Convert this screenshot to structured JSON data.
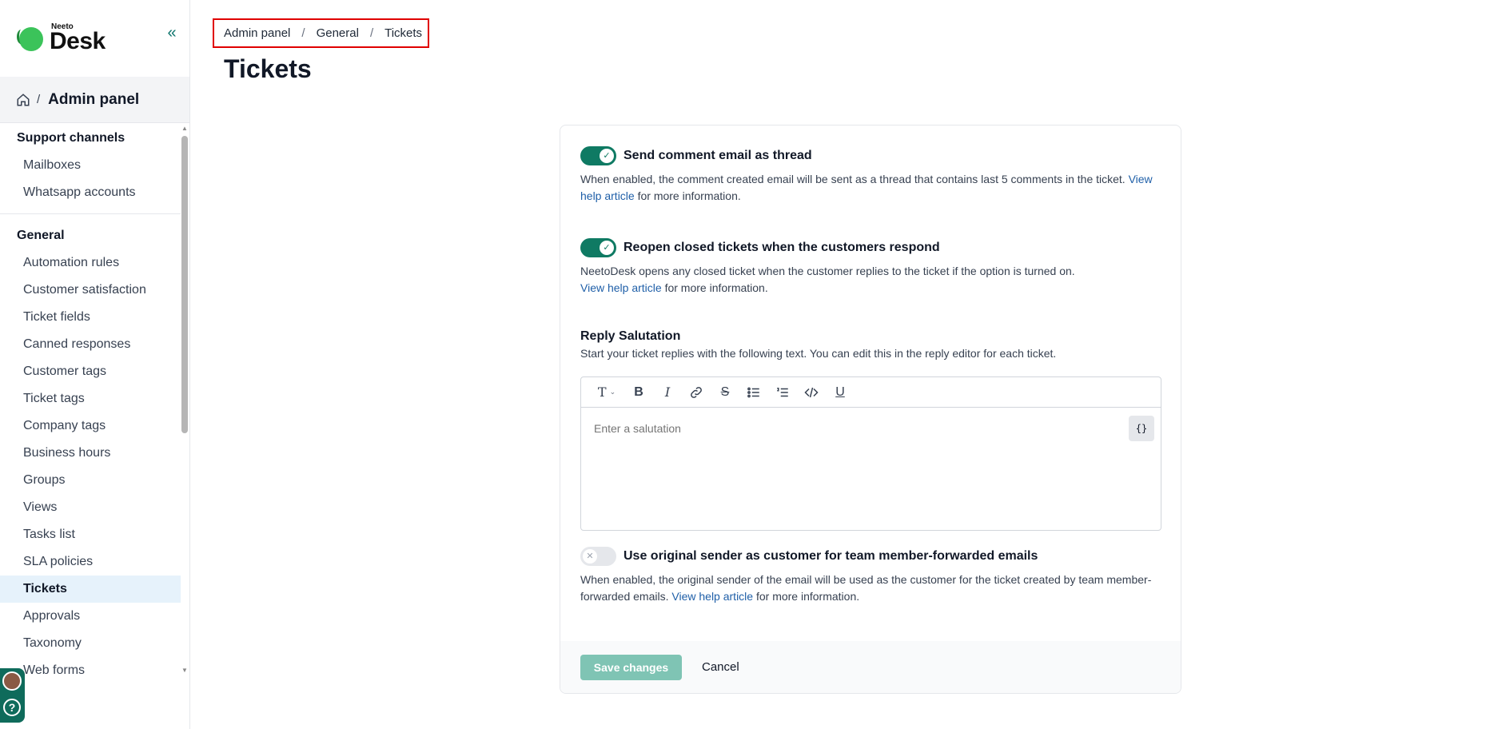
{
  "brand": {
    "small": "Neeto",
    "big": "Desk"
  },
  "admin_header": {
    "separator": "/",
    "title": "Admin panel"
  },
  "sidebar": {
    "sections": [
      {
        "label": "Support channels",
        "items": [
          "Mailboxes",
          "Whatsapp accounts"
        ]
      },
      {
        "label": "General",
        "items": [
          "Automation rules",
          "Customer satisfaction",
          "Ticket fields",
          "Canned responses",
          "Customer tags",
          "Ticket tags",
          "Company tags",
          "Business hours",
          "Groups",
          "Views",
          "Tasks list",
          "SLA policies",
          "Tickets",
          "Approvals",
          "Taxonomy",
          "Web forms"
        ]
      }
    ],
    "active_item": "Tickets"
  },
  "breadcrumb": {
    "items": [
      "Admin panel",
      "General",
      "Tickets"
    ],
    "separator": "/"
  },
  "page": {
    "title": "Tickets"
  },
  "settings": {
    "thread": {
      "enabled": true,
      "title": "Send comment email as thread",
      "desc_before": "When enabled, the comment created email will be sent as a thread that contains last 5 comments in the ticket.",
      "link": "View help article",
      "desc_after": "for more information."
    },
    "reopen": {
      "enabled": true,
      "title": "Reopen closed tickets when the customers respond",
      "desc_before": "NeetoDesk opens any closed ticket when the customer replies to the ticket if the option is turned on.",
      "link": "View help article",
      "desc_after": "for more information."
    },
    "salutation": {
      "title": "Reply Salutation",
      "desc": "Start your ticket replies with the following text. You can edit this in the reply editor for each ticket.",
      "placeholder": "Enter a salutation",
      "variable_button": "{}"
    },
    "original_sender": {
      "enabled": false,
      "title": "Use original sender as customer for team member-forwarded emails",
      "desc_before": "When enabled, the original sender of the email will be used as the customer for the ticket created by team member-forwarded emails.",
      "link": "View help article",
      "desc_after": "for more information."
    }
  },
  "footer": {
    "save_label": "Save changes",
    "cancel_label": "Cancel"
  },
  "colors": {
    "accent": "#0f7a63",
    "link": "#1f5fa8",
    "breadcrumb_highlight": "#e00000",
    "active_nav": "#e6f2fb"
  }
}
